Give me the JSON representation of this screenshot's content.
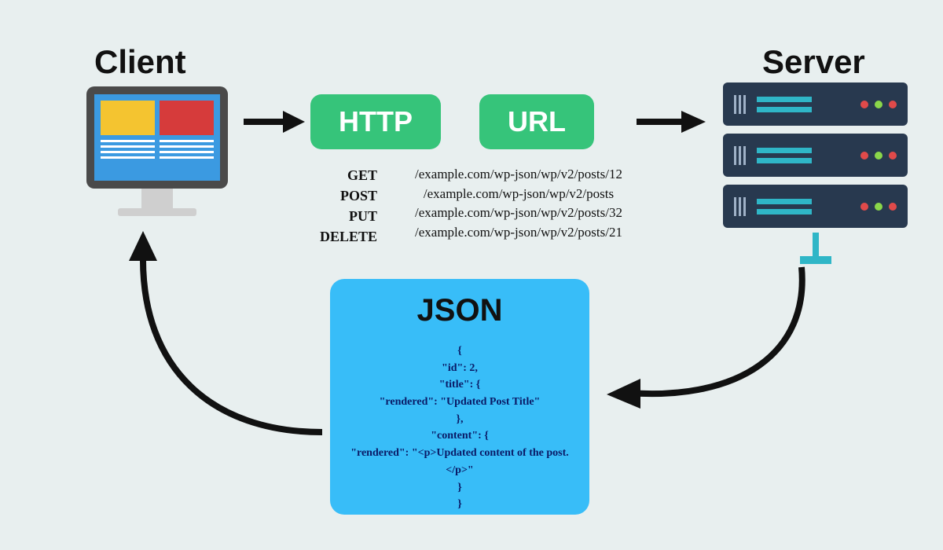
{
  "labels": {
    "client": "Client",
    "server": "Server",
    "http": "HTTP",
    "url": "URL",
    "json_title": "JSON"
  },
  "http_methods": [
    "GET",
    "POST",
    "PUT",
    "DELETE"
  ],
  "example_urls": [
    "/example.com/wp-json/wp/v2/posts/12",
    "/example.com/wp-json/wp/v2/posts",
    "/example.com/wp-json/wp/v2/posts/32",
    "/example.com/wp-json/wp/v2/posts/21"
  ],
  "json_lines": [
    "{",
    "\"id\": 2,",
    "\"title\": {",
    "\"rendered\": \"Updated Post Title\"",
    "},",
    "\"content\": {",
    "\"rendered\": \"<p>Updated content of the post.</p>\"",
    "}",
    "}"
  ]
}
